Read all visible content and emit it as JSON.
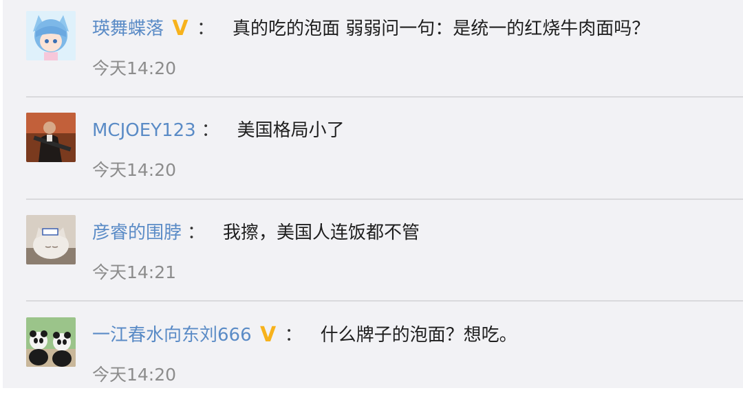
{
  "comments": [
    {
      "username": "瑛舞蝶落",
      "vip": true,
      "vip_icon": "vip-v-icon",
      "text": "真的吃的泡面 弱弱问一句：是统一的红烧牛肉面吗？",
      "time": "今天14:20",
      "avatar_icon": "anime-girl-avatar"
    },
    {
      "username": "MCJOEY123",
      "vip": false,
      "text": "美国格局小了",
      "time": "今天14:20",
      "avatar_icon": "gunman-avatar"
    },
    {
      "username": "彦睿的围脖",
      "vip": false,
      "text": "我擦，美国人连饭都不管",
      "time": "今天14:21",
      "avatar_icon": "cat-avatar"
    },
    {
      "username": "一江春水向东刘666",
      "vip": true,
      "vip_icon": "vip-v-icon",
      "text": "什么牌子的泡面？想吃。",
      "time": "今天14:20",
      "avatar_icon": "pandas-avatar"
    }
  ],
  "colon": "：",
  "vip_mark": "V",
  "colors": {
    "username": "#5a8bc6",
    "vip": "#f7b21c",
    "time": "#8c8c8c",
    "background": "#f2f2f5"
  }
}
